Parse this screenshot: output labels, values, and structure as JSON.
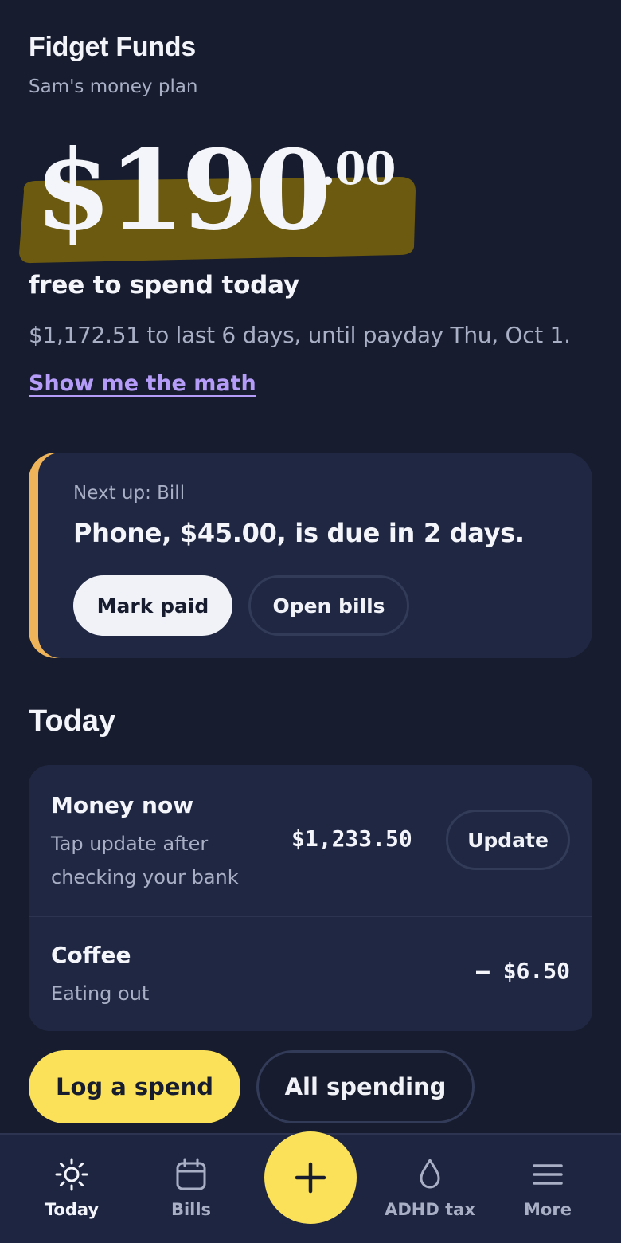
{
  "app": {
    "title": "Fidget Funds",
    "subtitle": "Sam's money plan"
  },
  "hero": {
    "amount": "$190",
    "cents": ".00",
    "caption": "free to spend today",
    "detail": "$1,172.51 to last 6 days, until payday Thu, Oct 1.",
    "math_link": "Show me the math",
    "highlight_color": "#6b5a10"
  },
  "next_up": {
    "label": "Next up: Bill",
    "text": "Phone, $45.00, is due in 2 days.",
    "mark_paid": "Mark paid",
    "open_bills": "Open bills",
    "accent_color": "#efb45a"
  },
  "today": {
    "title": "Today",
    "rows": [
      {
        "title": "Money now",
        "subtitle_line1": "Tap update after",
        "subtitle_line2": "checking your bank",
        "amount": "$1,233.50",
        "action": "Update"
      },
      {
        "title": "Coffee",
        "subtitle_line1": "Eating out",
        "amount": "– $6.50"
      }
    ]
  },
  "actions": {
    "log_spend": "Log a spend",
    "all_spending": "All spending"
  },
  "nav": {
    "items": [
      {
        "label": "Today",
        "icon": "sun-icon",
        "active": true
      },
      {
        "label": "Bills",
        "icon": "calendar-icon"
      },
      {
        "label": "ADHD tax",
        "icon": "droplet-icon"
      },
      {
        "label": "More",
        "icon": "menu-icon"
      }
    ],
    "fab_icon": "plus-icon"
  },
  "colors": {
    "background": "#171c2e",
    "card": "#1f2742",
    "accent_yellow": "#fbe15a",
    "link_purple": "#b49cf8"
  }
}
